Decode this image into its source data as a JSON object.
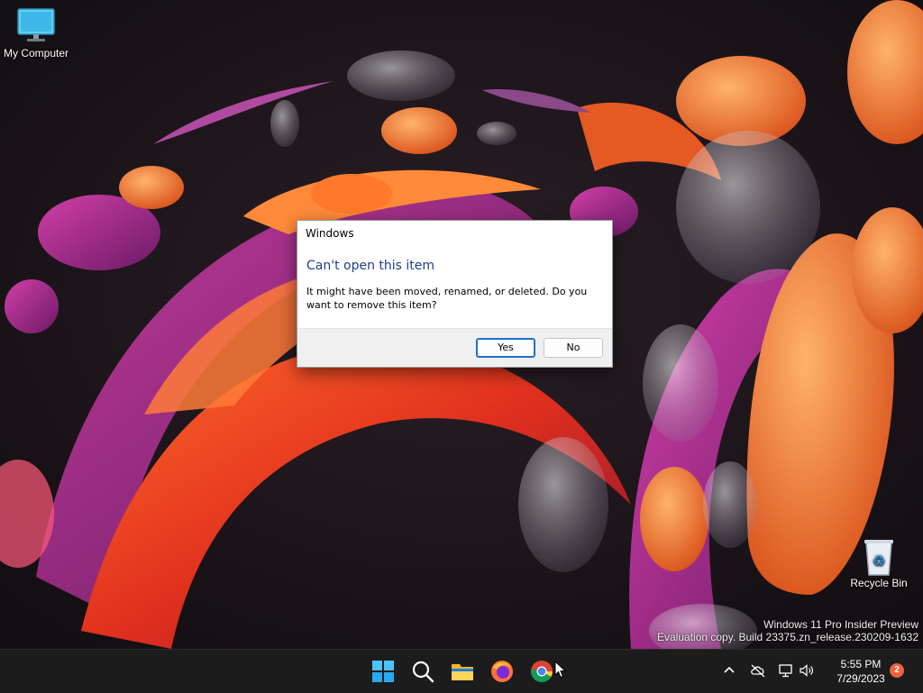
{
  "desktop": {
    "icons": [
      {
        "label": "My Computer"
      },
      {
        "label": "Recycle Bin"
      }
    ],
    "watermark": {
      "line1": "Windows 11 Pro Insider Preview",
      "line2": "Evaluation copy. Build 23375.zn_release.230209-1632"
    }
  },
  "dialog": {
    "title": "Windows",
    "heading": "Can't open this item",
    "message": "It might have been moved, renamed, or deleted. Do you want to remove this item?",
    "yes_label": "Yes",
    "no_label": "No"
  },
  "taskbar": {
    "apps": [
      "start-icon",
      "search-icon",
      "file-explorer-icon",
      "firefox-icon",
      "chrome-icon"
    ],
    "tray": [
      "chevron-up-icon",
      "cloud-off-icon",
      "network-icon",
      "volume-icon"
    ],
    "time": "5:55 PM",
    "date": "7/29/2023",
    "notification_count": "2"
  },
  "colors": {
    "dialog_heading": "#1f3f8a",
    "default_button_border": "#1f6fd4",
    "taskbar_bg": "#1c1c1c",
    "badge": "#f0603c"
  }
}
